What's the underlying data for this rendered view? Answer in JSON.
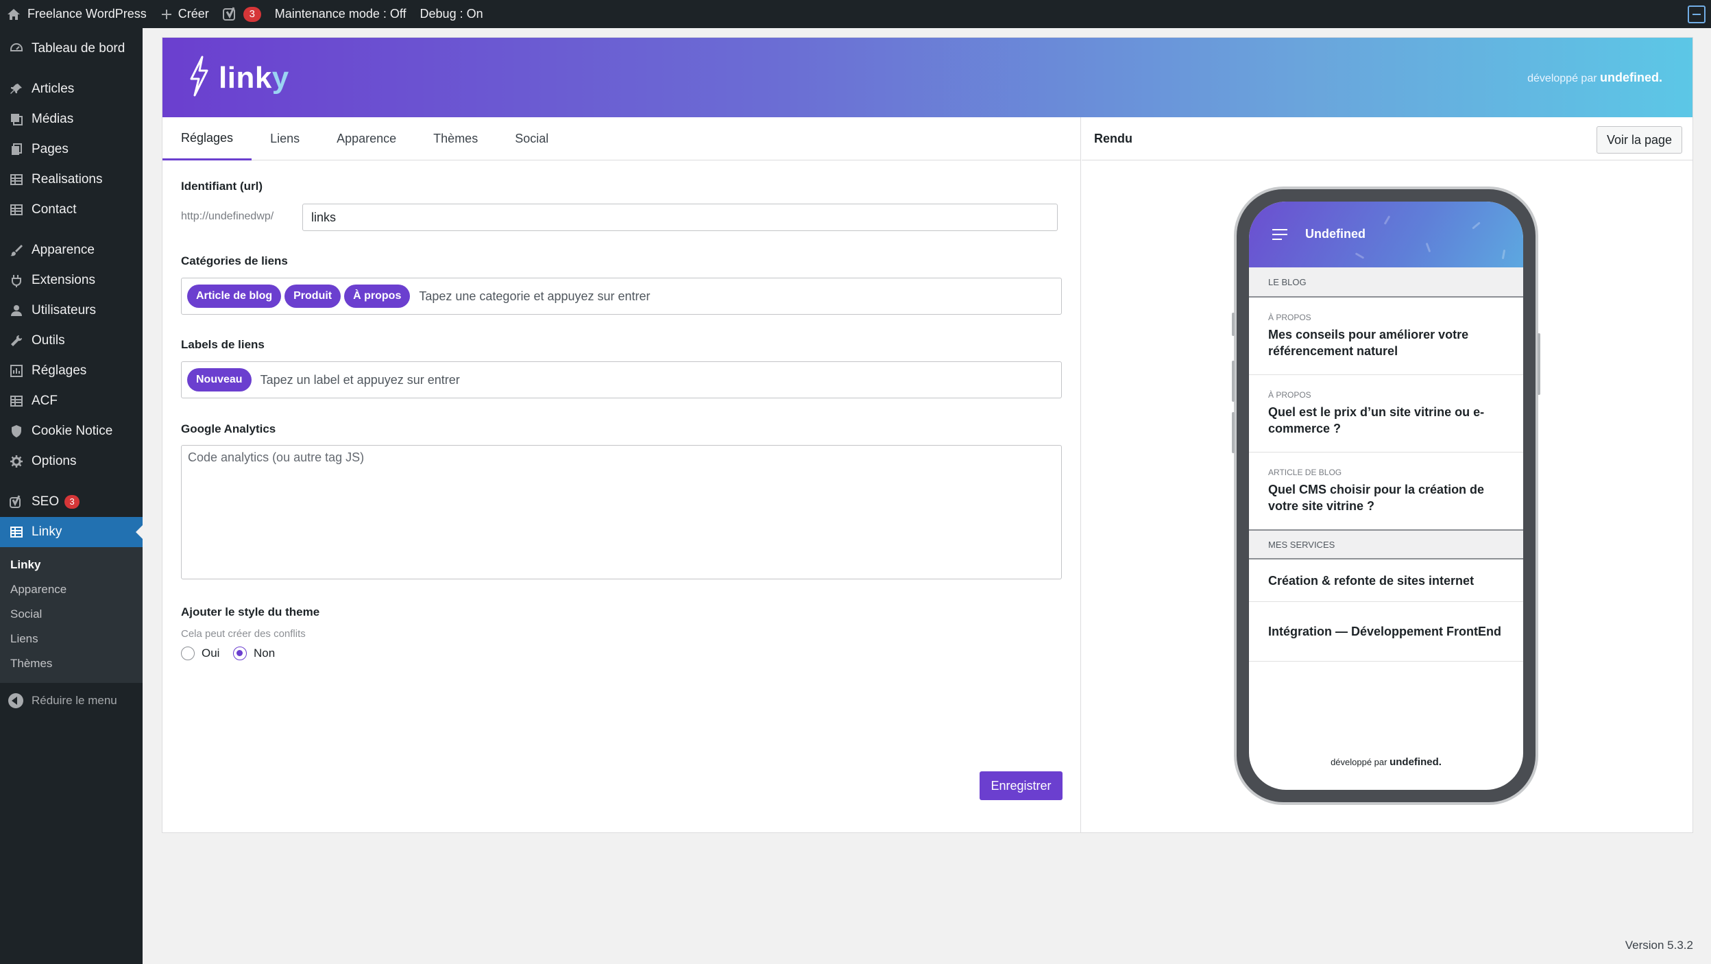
{
  "adminbar": {
    "site_name": "Freelance WordPress",
    "new_label": "Créer",
    "yoast_count": "3",
    "maintenance": "Maintenance mode : Off",
    "debug": "Debug : On"
  },
  "sidebar": {
    "items": [
      {
        "label": "Tableau de bord",
        "icon": "dashboard-icon"
      },
      {
        "label": "Articles",
        "icon": "pin-icon"
      },
      {
        "label": "Médias",
        "icon": "media-icon"
      },
      {
        "label": "Pages",
        "icon": "pages-icon"
      },
      {
        "label": "Realisations",
        "icon": "table-icon"
      },
      {
        "label": "Contact",
        "icon": "table-icon"
      },
      {
        "label": "Apparence",
        "icon": "brush-icon"
      },
      {
        "label": "Extensions",
        "icon": "plugin-icon"
      },
      {
        "label": "Utilisateurs",
        "icon": "user-icon"
      },
      {
        "label": "Outils",
        "icon": "wrench-icon"
      },
      {
        "label": "Réglages",
        "icon": "settings-icon"
      },
      {
        "label": "ACF",
        "icon": "table-icon"
      },
      {
        "label": "Cookie Notice",
        "icon": "shield-icon"
      },
      {
        "label": "Options",
        "icon": "gear-icon"
      },
      {
        "label": "SEO",
        "icon": "yoast-icon",
        "badge": "3"
      },
      {
        "label": "Linky",
        "icon": "table-icon"
      }
    ],
    "submenu": [
      "Linky",
      "Apparence",
      "Social",
      "Liens",
      "Thèmes"
    ],
    "collapse_label": "Réduire le menu"
  },
  "header": {
    "logo_text_main": "link",
    "logo_text_accent": "y",
    "credit_prefix": "développé par",
    "credit_brand": "undefined."
  },
  "tabs": [
    "Réglages",
    "Liens",
    "Apparence",
    "Thèmes",
    "Social"
  ],
  "form": {
    "identifier_label": "Identifiant (url)",
    "url_prefix": "http://undefinedwp/",
    "identifier_value": "links",
    "categories_label": "Catégories de liens",
    "categories": [
      "Article de blog",
      "Produit",
      "À propos"
    ],
    "categories_placeholder": "Tapez une categorie et appuyez sur entrer",
    "labels_label": "Labels de liens",
    "labels": [
      "Nouveau"
    ],
    "labels_placeholder": "Tapez un label et appuyez sur entrer",
    "analytics_label": "Google Analytics",
    "analytics_placeholder": "Code analytics (ou autre tag JS)",
    "theme_style_label": "Ajouter le style du theme",
    "theme_style_help": "Cela peut créer des conflits",
    "radio_yes": "Oui",
    "radio_no": "Non",
    "radio_selected": "Non",
    "save_label": "Enregistrer"
  },
  "preview": {
    "title": "Rendu",
    "view_button": "Voir la page",
    "site_name": "Undefined",
    "section_blog": "LE BLOG",
    "posts": [
      {
        "category": "À PROPOS",
        "title": "Mes conseils pour améliorer votre référencement naturel"
      },
      {
        "category": "À PROPOS",
        "title": "Quel est le prix d’un site vitrine ou e-commerce ?"
      },
      {
        "category": "ARTICLE DE BLOG",
        "title": "Quel CMS choisir pour la création de votre site vitrine ?"
      }
    ],
    "section_services": "MES SERVICES",
    "services": [
      "Création & refonte de sites internet",
      "Intégration — Développement FrontEnd"
    ],
    "footer_prefix": "développé par",
    "footer_brand": "undefined."
  },
  "footer": {
    "version": "Version 5.3.2"
  },
  "colors": {
    "accent": "#6b3fcf",
    "wp_blue": "#2271b1",
    "admin_dark": "#1d2327"
  }
}
